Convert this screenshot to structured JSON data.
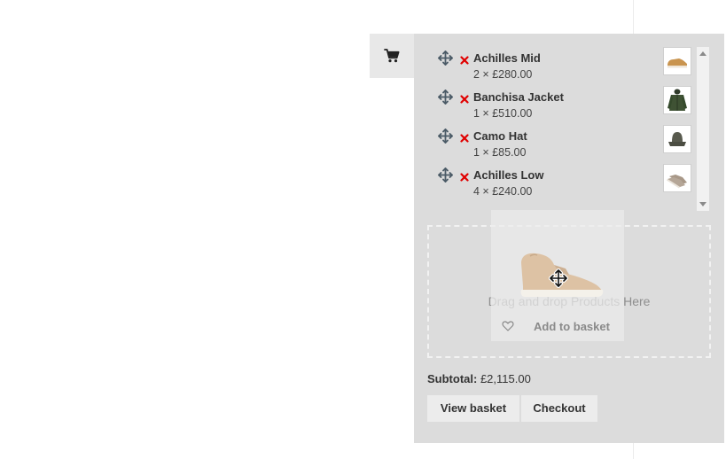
{
  "cart": {
    "toggle_icon": "shopping-cart-icon",
    "items": [
      {
        "name": "Achilles Mid",
        "qty_price": "2 × £280.00",
        "thumb": "mid-sneaker-thumbnail"
      },
      {
        "name": "Banchisa Jacket",
        "qty_price": "1 × £510.00",
        "thumb": "green-jacket-thumbnail"
      },
      {
        "name": "Camo Hat",
        "qty_price": "1 × £85.00",
        "thumb": "bucket-hat-thumbnail"
      },
      {
        "name": "Achilles Low",
        "qty_price": "4 × £240.00",
        "thumb": "low-sneaker-thumbnail"
      }
    ],
    "drop_zone_text": "Drag and drop Products Here",
    "subtotal_label": "Subtotal:",
    "subtotal_value": "£2,115.00",
    "view_basket_label": "View basket",
    "checkout_label": "Checkout"
  },
  "drag_ghost": {
    "add_to_basket_label": "Add to basket",
    "image": "beige-high-top-sneaker",
    "heart_icon": "heart-outline-icon",
    "cursor_icon": "move-cursor-icon"
  },
  "colors": {
    "panel_background": "#dcdcdc",
    "remove_icon": "#e00000",
    "move_icon": "#4a5a66",
    "button_background": "#ececec"
  }
}
